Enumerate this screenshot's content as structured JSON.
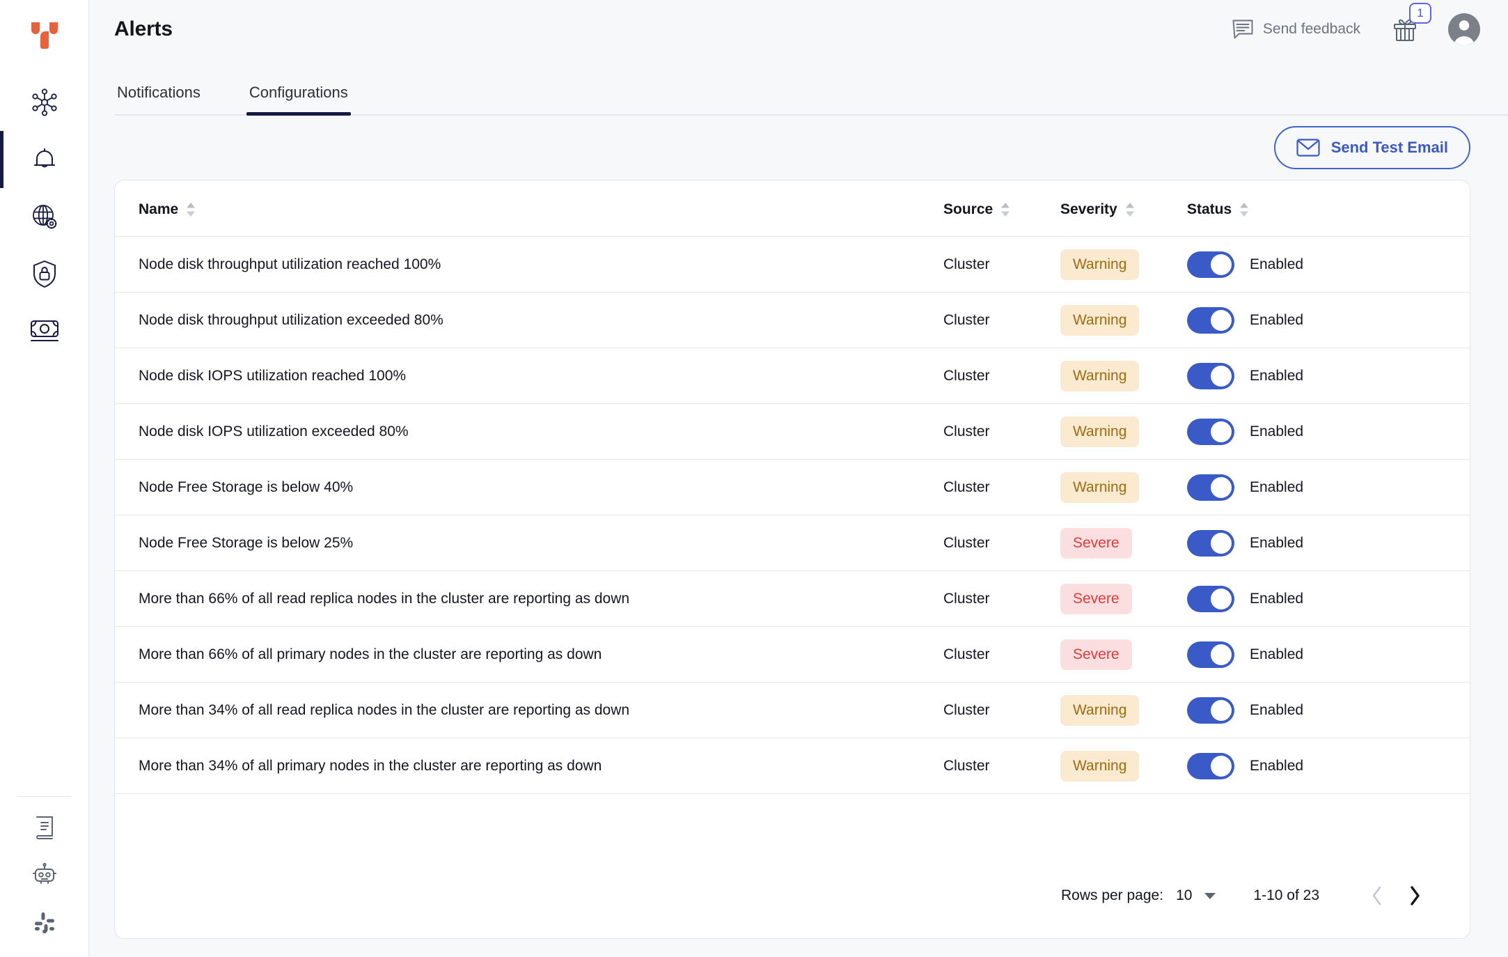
{
  "sidebar": {
    "logo": {
      "icon": "yugabyte-logo"
    },
    "top_items": [
      {
        "icon": "cluster-network-icon",
        "name": "clusters",
        "active": false
      },
      {
        "icon": "bell-icon",
        "name": "alerts",
        "active": true
      },
      {
        "icon": "globe-gear-icon",
        "name": "network-settings",
        "active": false
      },
      {
        "icon": "shield-lock-icon",
        "name": "security",
        "active": false
      },
      {
        "icon": "money-bill-icon",
        "name": "billing",
        "active": false
      }
    ],
    "bottom_items": [
      {
        "icon": "book-docs-icon",
        "name": "documentation",
        "active": false
      },
      {
        "icon": "robot-icon",
        "name": "support-bot",
        "active": false
      },
      {
        "icon": "slack-icon",
        "name": "slack-community",
        "active": false
      }
    ]
  },
  "header": {
    "title": "Alerts",
    "feedback_label": "Send feedback",
    "feedback_icon": "speech-bubble-icon",
    "gift_icon": "gift-icon",
    "gift_badge_count": "1",
    "avatar_icon": "user-avatar-icon"
  },
  "tabs": [
    {
      "label": "Notifications",
      "active": false
    },
    {
      "label": "Configurations",
      "active": true
    }
  ],
  "toolbar": {
    "send_test_email_label": "Send Test Email",
    "send_test_email_icon": "envelope-icon"
  },
  "table": {
    "columns": [
      {
        "label": "Name",
        "sortable": true
      },
      {
        "label": "Source",
        "sortable": true
      },
      {
        "label": "Severity",
        "sortable": true
      },
      {
        "label": "Status",
        "sortable": true
      }
    ],
    "rows": [
      {
        "name": "Node disk throughput utilization reached 100%",
        "source": "Cluster",
        "severity": "Warning",
        "severity_kind": "warning",
        "status": "Enabled",
        "enabled": true
      },
      {
        "name": "Node disk throughput utilization exceeded 80%",
        "source": "Cluster",
        "severity": "Warning",
        "severity_kind": "warning",
        "status": "Enabled",
        "enabled": true
      },
      {
        "name": "Node disk IOPS utilization reached 100%",
        "source": "Cluster",
        "severity": "Warning",
        "severity_kind": "warning",
        "status": "Enabled",
        "enabled": true
      },
      {
        "name": "Node disk IOPS utilization exceeded 80%",
        "source": "Cluster",
        "severity": "Warning",
        "severity_kind": "warning",
        "status": "Enabled",
        "enabled": true
      },
      {
        "name": "Node Free Storage is below 40%",
        "source": "Cluster",
        "severity": "Warning",
        "severity_kind": "warning",
        "status": "Enabled",
        "enabled": true
      },
      {
        "name": "Node Free Storage is below 25%",
        "source": "Cluster",
        "severity": "Severe",
        "severity_kind": "severe",
        "status": "Enabled",
        "enabled": true
      },
      {
        "name": "More than 66% of all read replica nodes in the cluster are reporting as down",
        "source": "Cluster",
        "severity": "Severe",
        "severity_kind": "severe",
        "status": "Enabled",
        "enabled": true
      },
      {
        "name": "More than 66% of all primary nodes in the cluster are reporting as down",
        "source": "Cluster",
        "severity": "Severe",
        "severity_kind": "severe",
        "status": "Enabled",
        "enabled": true
      },
      {
        "name": "More than 34% of all read replica nodes in the cluster are reporting as down",
        "source": "Cluster",
        "severity": "Warning",
        "severity_kind": "warning",
        "status": "Enabled",
        "enabled": true
      },
      {
        "name": "More than 34% of all primary nodes in the cluster are reporting as down",
        "source": "Cluster",
        "severity": "Warning",
        "severity_kind": "warning",
        "status": "Enabled",
        "enabled": true
      }
    ]
  },
  "pagination": {
    "rows_per_page_label": "Rows per page:",
    "rows_per_page_value": "10",
    "range_label": "1-10 of 23",
    "prev_enabled": false,
    "next_enabled": true
  },
  "colors": {
    "accent_blue": "#3a5bc7",
    "brand_orange": "#e8603c",
    "navy": "#151943",
    "warning_bg": "#fbead0",
    "warning_fg": "#9b6c10",
    "severe_bg": "#fbdfe0",
    "severe_fg": "#e03b3b",
    "page_bg": "#f7f8fa"
  }
}
